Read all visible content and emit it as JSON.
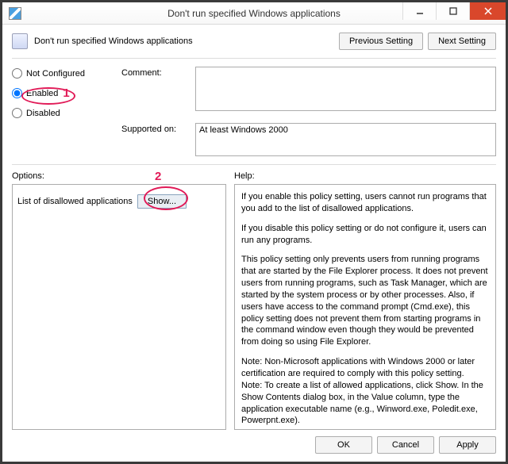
{
  "window": {
    "title": "Don't run specified Windows applications"
  },
  "header": {
    "policy_name": "Don't run specified Windows applications",
    "prev_btn": "Previous Setting",
    "next_btn": "Next Setting"
  },
  "state": {
    "not_configured": "Not Configured",
    "enabled": "Enabled",
    "disabled": "Disabled",
    "selected": "enabled"
  },
  "labels": {
    "comment": "Comment:",
    "supported": "Supported on:",
    "options": "Options:",
    "help": "Help:",
    "list_label": "List of disallowed applications",
    "show_btn": "Show..."
  },
  "fields": {
    "comment_value": "",
    "supported_value": "At least Windows 2000"
  },
  "help": {
    "p1": "If you enable this policy setting, users cannot run programs that you add to the list of disallowed applications.",
    "p2": "If you disable this policy setting or do not configure it, users can run any programs.",
    "p3": "This policy setting only prevents users from running programs that are started by the File Explorer process. It does not prevent users from running programs, such as Task Manager, which are started by the system process or by other processes.  Also, if users have access to the command prompt (Cmd.exe), this policy setting does not prevent them from starting programs in the command window even though they would be prevented from doing so using File Explorer.",
    "p4": "Note: Non-Microsoft applications with Windows 2000 or later certification are required to comply with this policy setting.\nNote: To create a list of allowed applications, click Show.  In the Show Contents dialog box, in the Value column, type the application executable name (e.g., Winword.exe, Poledit.exe, Powerpnt.exe)."
  },
  "footer": {
    "ok": "OK",
    "cancel": "Cancel",
    "apply": "Apply"
  },
  "annotations": {
    "one": "1",
    "two": "2"
  }
}
